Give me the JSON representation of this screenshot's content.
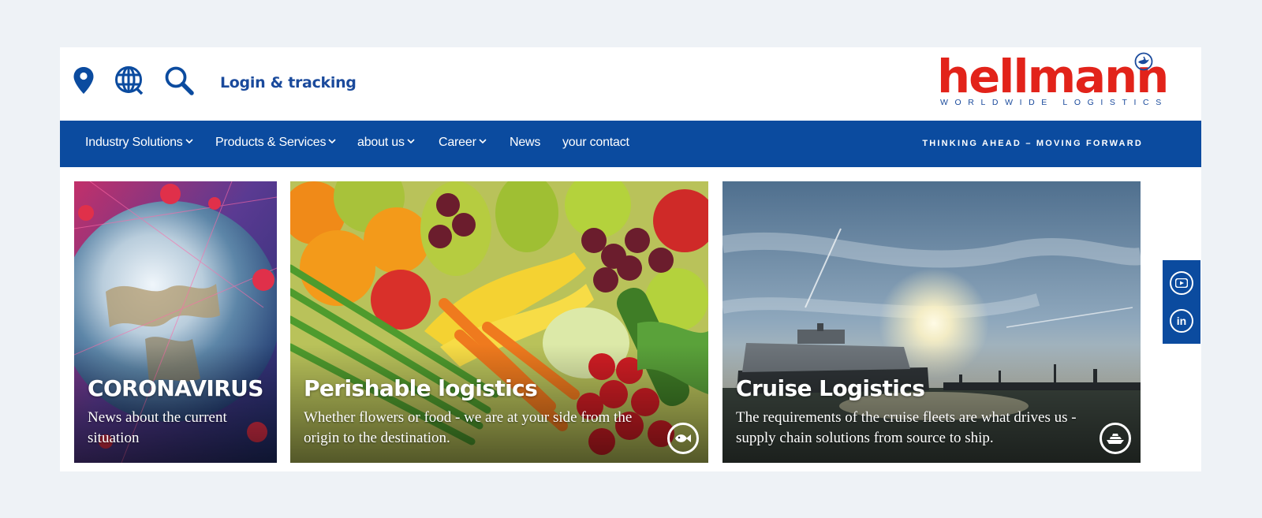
{
  "header": {
    "icons": [
      "location-pin-icon",
      "globe-icon",
      "search-icon"
    ],
    "login_label": "Login & tracking"
  },
  "logo": {
    "word": "hellmann",
    "tagline": "WORLDWIDE LOGISTICS"
  },
  "nav": {
    "items": [
      {
        "label": "Industry Solutions",
        "dropdown": true
      },
      {
        "label": "Products & Services",
        "dropdown": true
      },
      {
        "label": "about us",
        "dropdown": true
      },
      {
        "label": "Career",
        "dropdown": true
      },
      {
        "label": "News",
        "dropdown": false
      },
      {
        "label": "your contact",
        "dropdown": false
      }
    ],
    "slogan": "THINKING AHEAD – MOVING FORWARD"
  },
  "cards": [
    {
      "title": "CORONAVIRUS",
      "text": "News about the current situation",
      "icon": null
    },
    {
      "title": "Perishable logistics",
      "text": "Whether flowers or food - we are at your side from the origin to the destination.",
      "icon": "fish-icon"
    },
    {
      "title": "Cruise Logistics",
      "text": "The requirements of the cruise fleets are what drives us - supply chain solutions from source to ship.",
      "icon": "cruise-ship-icon"
    }
  ],
  "social": {
    "items": [
      {
        "icon": "youtube-icon"
      },
      {
        "icon": "linkedin-icon",
        "label": "in"
      }
    ]
  },
  "colors": {
    "brand_blue": "#0b4b9f",
    "brand_red": "#e2231a",
    "background": "#eef2f6"
  }
}
